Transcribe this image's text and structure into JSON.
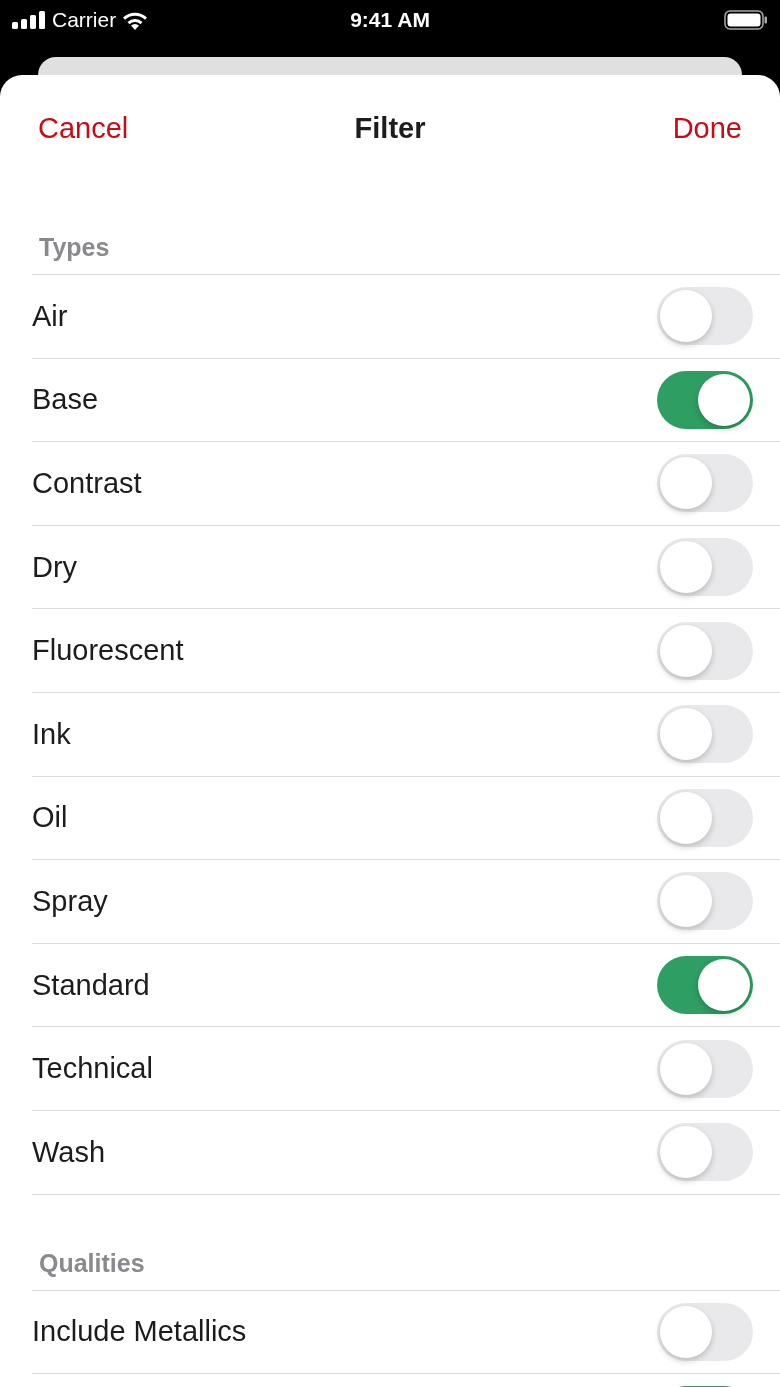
{
  "status_bar": {
    "carrier": "Carrier",
    "time": "9:41 AM"
  },
  "nav": {
    "cancel": "Cancel",
    "title": "Filter",
    "done": "Done"
  },
  "sections": [
    {
      "title": "Types",
      "items": [
        {
          "label": "Air",
          "on": false
        },
        {
          "label": "Base",
          "on": true
        },
        {
          "label": "Contrast",
          "on": false
        },
        {
          "label": "Dry",
          "on": false
        },
        {
          "label": "Fluorescent",
          "on": false
        },
        {
          "label": "Ink",
          "on": false
        },
        {
          "label": "Oil",
          "on": false
        },
        {
          "label": "Spray",
          "on": false
        },
        {
          "label": "Standard",
          "on": true
        },
        {
          "label": "Technical",
          "on": false
        },
        {
          "label": "Wash",
          "on": false
        }
      ]
    },
    {
      "title": "Qualities",
      "items": [
        {
          "label": "Include Metallics",
          "on": false
        },
        {
          "on": true
        }
      ]
    }
  ]
}
